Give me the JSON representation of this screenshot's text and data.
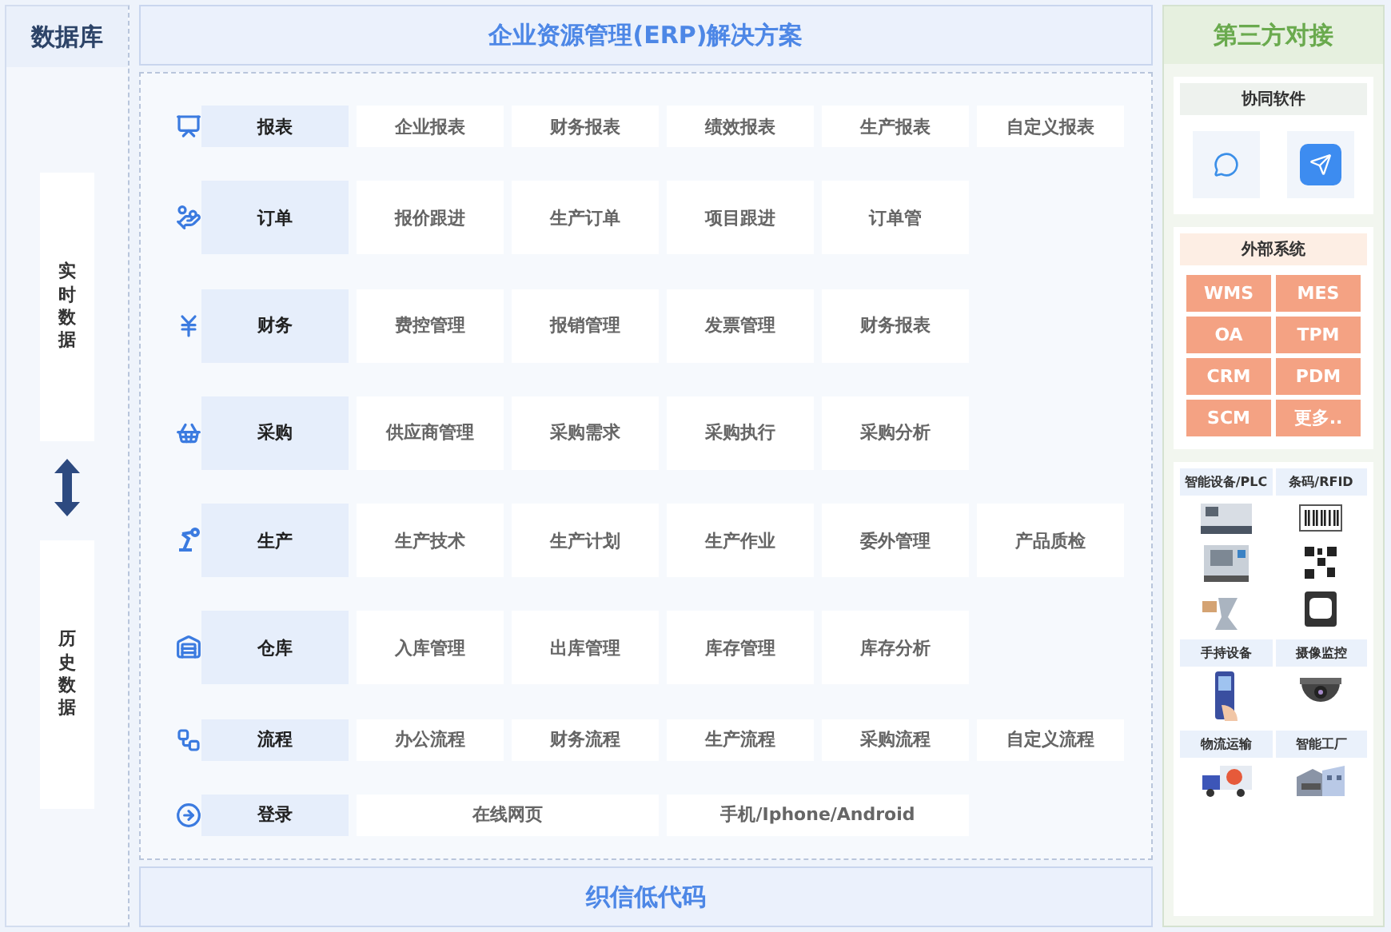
{
  "database": {
    "title": "数据库",
    "blocks": [
      "实时数据",
      "历史数据"
    ]
  },
  "erp": {
    "title": "企业资源管理(ERP)解决方案",
    "footer": "织信低代码",
    "modules": [
      {
        "label": "报表",
        "kind": "short",
        "items": [
          "企业报表",
          "财务报表",
          "绩效报表",
          "生产报表",
          "自定义报表"
        ]
      },
      {
        "label": "订单",
        "kind": "tall",
        "items": [
          "报价跟进",
          "生产订单",
          "项目跟进",
          "订单管"
        ]
      },
      {
        "label": "财务",
        "kind": "tall",
        "items": [
          "费控管理",
          "报销管理",
          "发票管理",
          "财务报表"
        ]
      },
      {
        "label": "采购",
        "kind": "tall",
        "items": [
          "供应商管理",
          "采购需求",
          "采购执行",
          "采购分析"
        ]
      },
      {
        "label": "生产",
        "kind": "tall",
        "items": [
          "生产技术",
          "生产计划",
          "生产作业",
          "委外管理",
          "产品质检"
        ]
      },
      {
        "label": "仓库",
        "kind": "tall",
        "items": [
          "入库管理",
          "出库管理",
          "库存管理",
          "库存分析"
        ]
      },
      {
        "label": "流程",
        "kind": "short",
        "items": [
          "办公流程",
          "财务流程",
          "生产流程",
          "采购流程",
          "自定义流程"
        ]
      },
      {
        "label": "登录",
        "kind": "wide",
        "items": [
          "在线网页",
          "手机/Iphone/Android"
        ]
      }
    ]
  },
  "third_party": {
    "title": "第三方对接",
    "collab": {
      "title": "协同软件"
    },
    "external": {
      "title": "外部系统",
      "systems": [
        "WMS",
        "MES",
        "OA",
        "TPM",
        "CRM",
        "PDM",
        "SCM",
        "更多.."
      ]
    },
    "devices": [
      "智能设备/PLC",
      "条码/RFID",
      "手持设备",
      "摄像监控",
      "物流运输",
      "智能工厂"
    ]
  }
}
